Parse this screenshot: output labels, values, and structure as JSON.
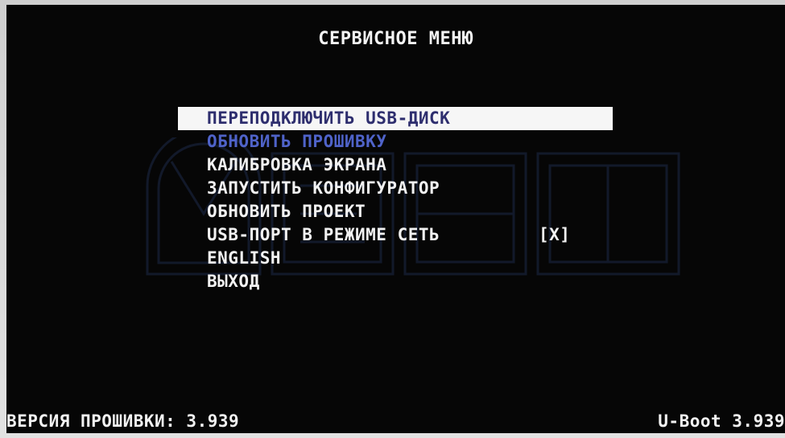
{
  "screen": {
    "title": "СЕРВИСНОЕ МЕНЮ"
  },
  "menu": {
    "items": [
      {
        "label": "ПЕРЕПОДКЛЮЧИТЬ USB-ДИСК",
        "state": "selected"
      },
      {
        "label": "ОБНОВИТЬ ПРОШИВКУ",
        "state": "disabled"
      },
      {
        "label": "КАЛИБРОВКА ЭКРАНА",
        "state": "normal"
      },
      {
        "label": "ЗАПУСТИТЬ КОНФИГУРАТОР",
        "state": "normal"
      },
      {
        "label": "ОБНОВИТЬ ПРОЕКТ",
        "state": "normal"
      },
      {
        "label": "USB-ПОРТ В РЕЖИМЕ СЕТЬ",
        "state": "normal",
        "checkbox": "[X]"
      },
      {
        "label": "ENGLISH",
        "state": "normal"
      },
      {
        "label": "ВЫХОД",
        "state": "normal"
      }
    ]
  },
  "footer": {
    "firmware_version": "ВЕРСИЯ ПРОШИВКИ: 3.939",
    "uboot_version": "U-Boot 3.939"
  },
  "colors": {
    "background": "#060606",
    "text": "#f2f2f2",
    "highlight_bg": "#f6f6f6",
    "highlight_text": "#2e2e6e",
    "disabled_text": "#4f63c9"
  }
}
